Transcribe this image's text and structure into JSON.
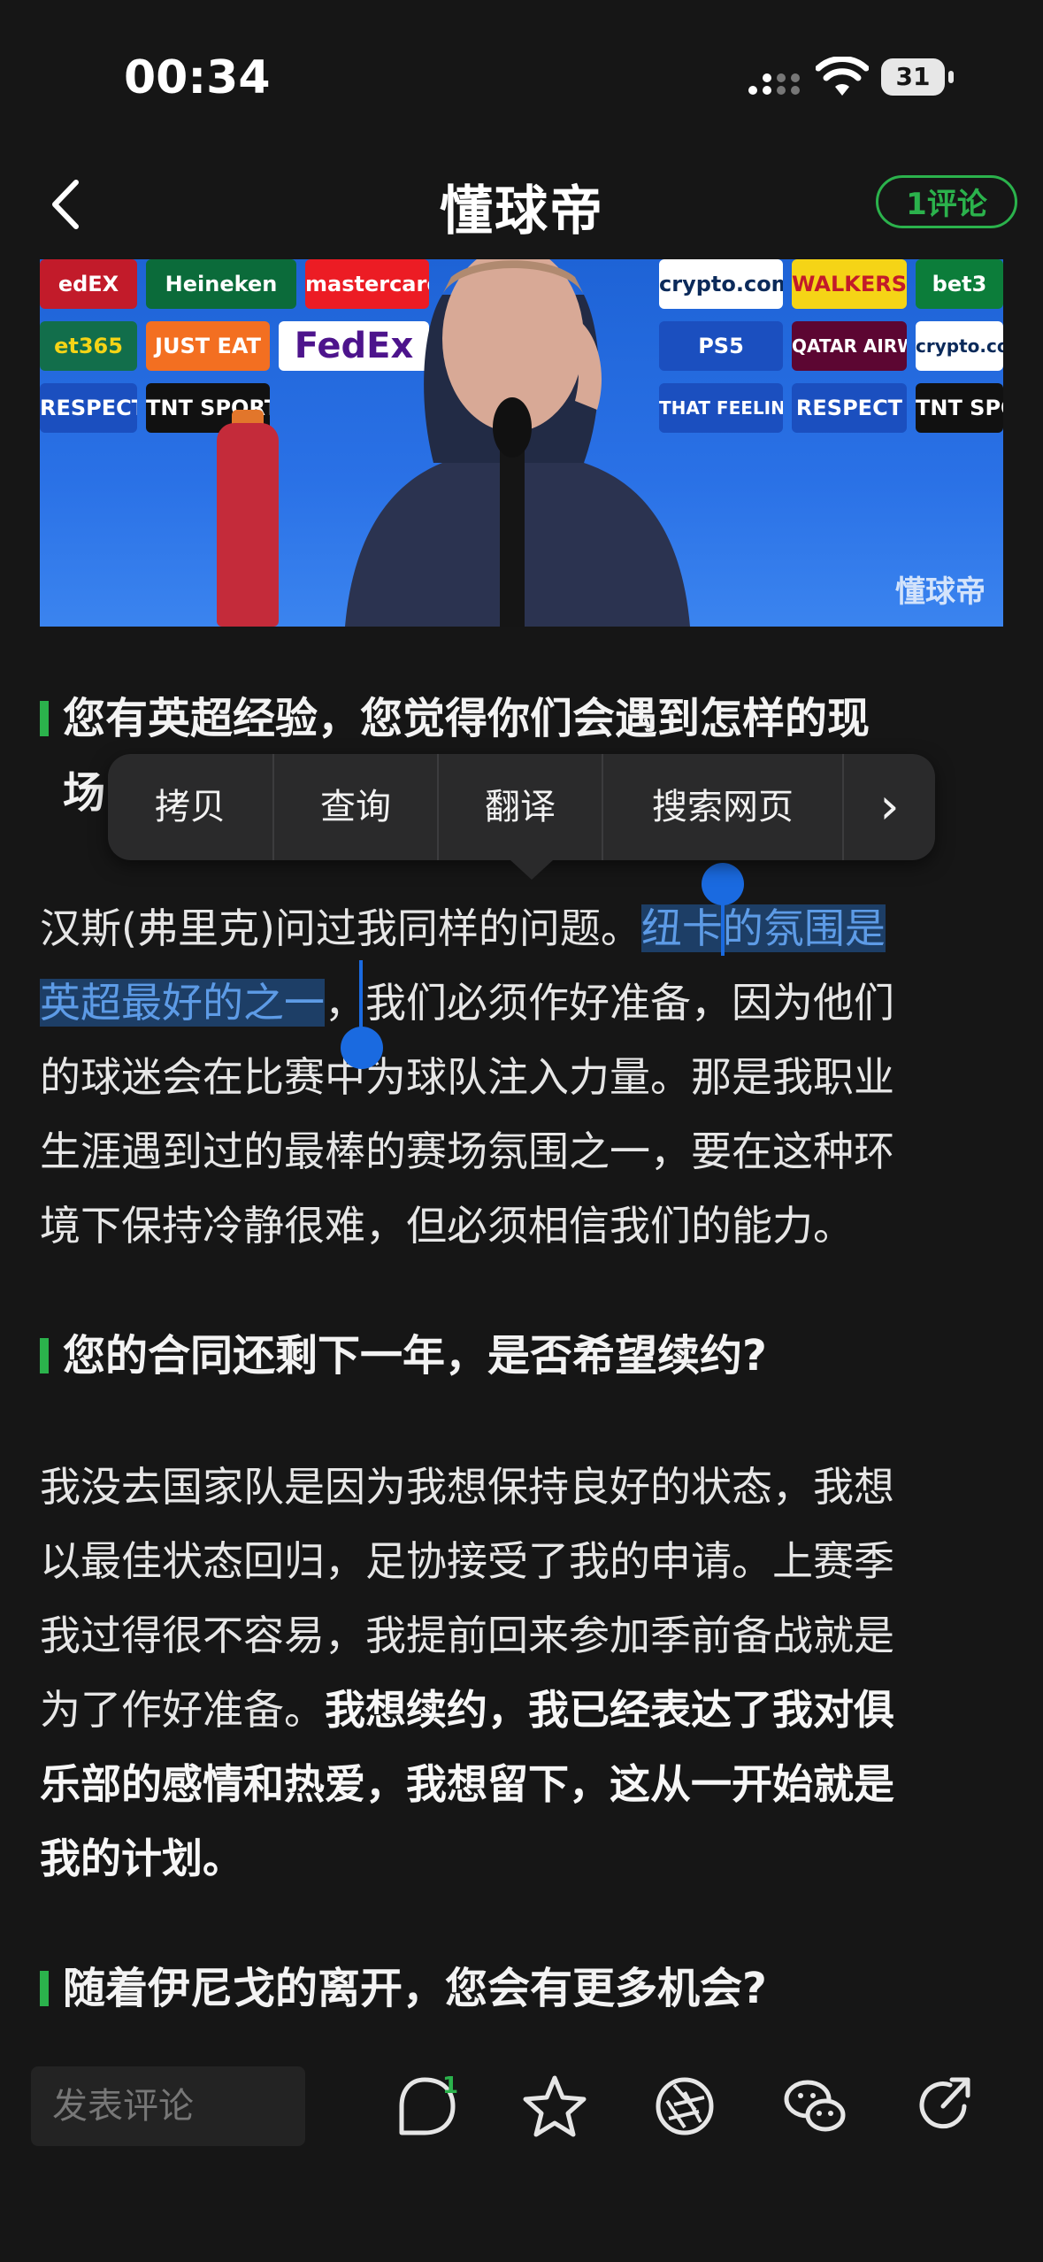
{
  "status_bar": {
    "time": "00:34",
    "battery": "31"
  },
  "nav": {
    "logo": "懂球帝",
    "comment_button": "1评论"
  },
  "hero": {
    "watermark": "懂球帝",
    "sponsors": [
      "Heineken",
      "mastercard",
      "crypto.com",
      "WALKERS",
      "bet3",
      "et365",
      "JUST EAT",
      "FedEx",
      "PS5",
      "QATAR AIRWAYS",
      "crypto.com",
      "RESPECT",
      "TNT SPORTS",
      "THAT FEELING",
      "RESPECT",
      "TNT SPOR"
    ]
  },
  "article": {
    "q1_line1": "您有英超经验，您觉得你们会遇到怎样的现",
    "q1_line2_visible": "场",
    "a1": {
      "l1_plain": "汉斯(弗里克)问过我同样的问题。",
      "l1_sel": "纽卡的氛围是",
      "l2_sel": "英超最好的之一",
      "l2_plain": "，我们必须作好准备，因为他们",
      "l3": "的球迷会在比赛中为球队注入力量。那是我职业",
      "l4": "生涯遇到过的最棒的赛场氛围之一，要在这种环",
      "l5": "境下保持冷静很难，但必须相信我们的能力。"
    },
    "q2": "您的合同还剩下一年，是否希望续约?",
    "a2": {
      "l1": "我没去国家队是因为我想保持良好的状态，我想",
      "l2": "以最佳状态回归，足协接受了我的申请。上赛季",
      "l3": "我过得很不容易，我提前回来参加季前备战就是",
      "l4_plain": "为了作好准备。",
      "l4_bold": "我想续约，我已经表达了我对俱",
      "l5_bold": "乐部的感情和热爱，我想留下，这从一开始就是",
      "l6_bold": "我的计划。"
    },
    "q3": "随着伊尼戈的离开，您会有更多机会?"
  },
  "context_menu": {
    "copy": "拷贝",
    "lookup": "查询",
    "translate": "翻译",
    "search_web": "搜索网页",
    "more": "›"
  },
  "bottom_bar": {
    "comment_placeholder": "发表评论",
    "comment_count": "1"
  },
  "colors": {
    "accent_green": "#2bb24c",
    "selection_blue": "#1a6ae0",
    "background": "#161616"
  },
  "icons": [
    "chevron-left-icon",
    "comment-icon",
    "star-icon",
    "shutter-icon",
    "wechat-icon",
    "share-icon",
    "wifi-icon",
    "signal-icon",
    "battery-icon"
  ]
}
